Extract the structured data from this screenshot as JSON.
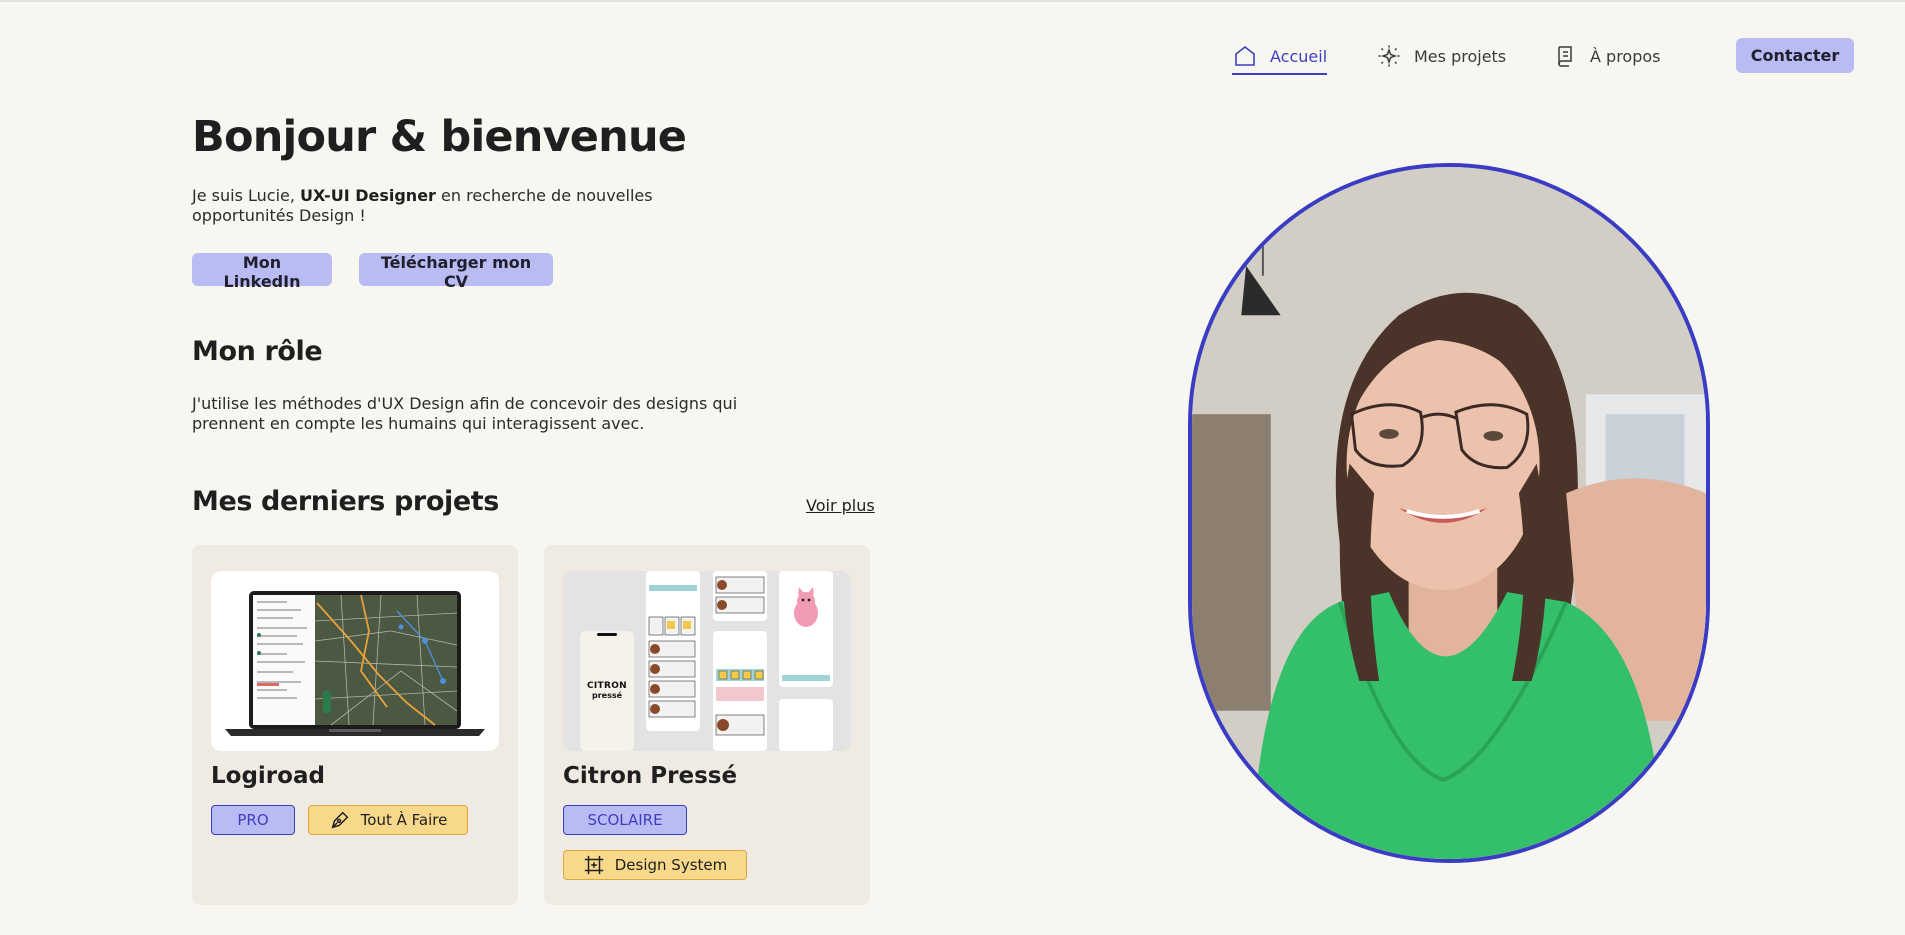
{
  "nav": {
    "home": {
      "label": "Accueil",
      "icon": "home-icon"
    },
    "projects": {
      "label": "Mes projets",
      "icon": "sparkle-icon"
    },
    "about": {
      "label": "À propos",
      "icon": "document-icon"
    },
    "contact_label": "Contacter"
  },
  "hero": {
    "title": "Bonjour & bienvenue",
    "intro_prefix": "Je suis Lucie, ",
    "intro_bold": "UX-UI Designer",
    "intro_suffix": " en recherche de nouvelles opportunités Design !",
    "linkedin_label": "Mon LinkedIn",
    "cv_label": "Télécharger mon CV"
  },
  "role": {
    "title": "Mon rôle",
    "text": "J'utilise les méthodes d'UX Design afin de concevoir des designs qui prennent en compte les humains qui interagissent avec."
  },
  "projects": {
    "title": "Mes derniers projets",
    "see_more": "Voir plus",
    "items": [
      {
        "title": "Logiroad",
        "tags": [
          {
            "label": "PRO",
            "style": "blue"
          },
          {
            "label": "Tout À Faire",
            "style": "yellow",
            "icon": "pen-icon"
          }
        ]
      },
      {
        "title": "Citron Pressé",
        "thumb_logo_line1": "CITRON",
        "thumb_logo_line2": "pressé",
        "tags": [
          {
            "label": "SCOLAIRE",
            "style": "blue"
          },
          {
            "label": "Design System",
            "style": "yellow",
            "icon": "frame-icon"
          }
        ]
      }
    ]
  },
  "colors": {
    "background": "#f7f6f1",
    "accent": "#3d3fc2",
    "button": "#b9bcf3",
    "tag_yellow": "#f8d88a",
    "card": "#efebe2"
  }
}
